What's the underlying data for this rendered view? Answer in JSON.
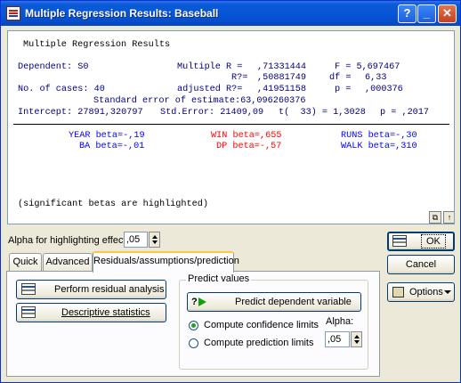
{
  "window": {
    "title": "Multiple Regression Results: Baseball",
    "buttons": {
      "help": "?",
      "minimize": "_",
      "close": "✕"
    }
  },
  "results": {
    "heading": "Multiple Regression Results",
    "row1a": "Dependent: S0",
    "row1b": "Multiple R =",
    "row1c": ",71331444",
    "row1d": "F = 5,697467",
    "row2a": "R?=",
    "row2b": ",50881749",
    "row2c": "df =",
    "row2d": "6,33",
    "row3a": "No. of cases: 40",
    "row3b": "adjusted R?=",
    "row3c": ",41951158",
    "row3d": "p =",
    "row3e": ",000376",
    "row4": "Standard error of estimate:63,096260376",
    "row5a": "Intercept: 27891,320797",
    "row5b": "Std.Error: 21409,09",
    "row5c": "t(  33) = 1,3028",
    "row5d": "p = ,2017",
    "betas": {
      "year": "YEAR beta=-,19",
      "win": "WIN beta=,655",
      "runs": "RUNS beta=-,30",
      "ba": "BA beta=-,01",
      "dp": "DP beta=-,57",
      "walk": "WALK beta=,310"
    },
    "note": "(significant betas are highlighted)"
  },
  "alpha": {
    "label": "Alpha for highlighting effects:",
    "value": ",05"
  },
  "tabs": [
    {
      "label": "Quick"
    },
    {
      "label": "Advanced"
    },
    {
      "label": "Residuals/assumptions/prediction"
    }
  ],
  "panel": {
    "perform_residual": "Perform residual analysis",
    "descriptive_stats": "Descriptive statistics",
    "predict_group": "Predict values",
    "predict_button": "Predict dependent variable",
    "conf_limits": "Compute confidence limits",
    "pred_limits": "Compute prediction limits",
    "alpha_label": "Alpha:",
    "alpha_value": ",05"
  },
  "side": {
    "ok": "OK",
    "cancel": "Cancel",
    "options": "Options"
  },
  "colors": {
    "titlebar": "#0554d6",
    "navy_text": "#000080",
    "highlight_red": "#ff0000",
    "blue_text": "#0000ff"
  }
}
